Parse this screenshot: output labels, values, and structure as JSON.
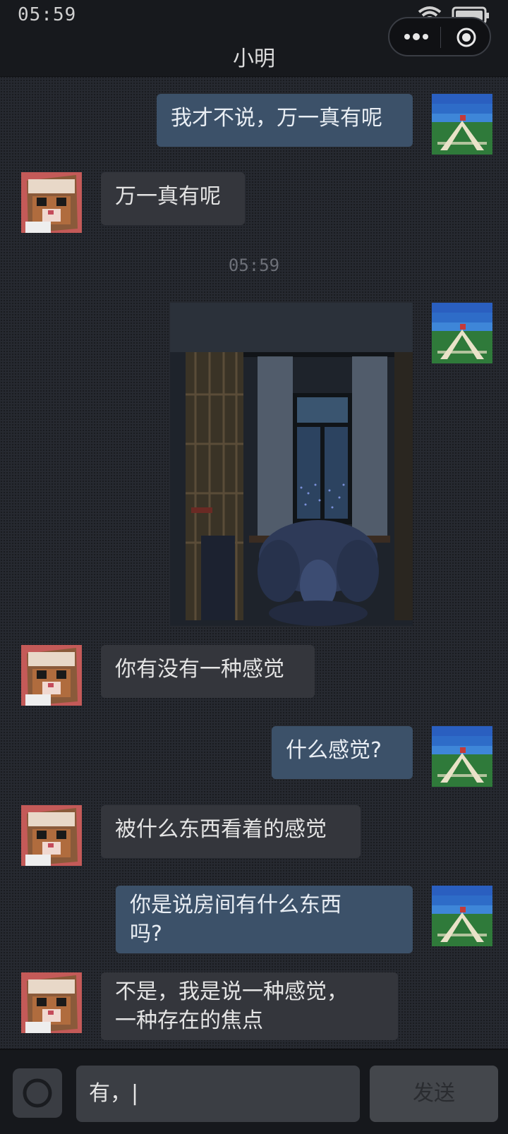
{
  "status_bar": {
    "time": "05:59"
  },
  "header": {
    "title": "小明"
  },
  "messages": [
    {
      "from": "me",
      "text": "我才不说，万一真有呢"
    },
    {
      "from": "them",
      "text": "万一真有呢"
    },
    {
      "type": "timestamp",
      "text": "05:59"
    },
    {
      "from": "me",
      "type": "image"
    },
    {
      "from": "them",
      "text": "你有没有一种感觉"
    },
    {
      "from": "me",
      "text": "什么感觉?"
    },
    {
      "from": "them",
      "text": "被什么东西看着的感觉"
    },
    {
      "from": "me",
      "text": "你是说房间有什么东西\n吗?"
    },
    {
      "from": "them",
      "text": "不是，我是说一种感觉，\n一种存在的焦点"
    }
  ],
  "composer": {
    "input_value": "有，|",
    "send_label": "发送"
  },
  "colors": {
    "my_bubble": "#3c5169",
    "their_bubble": "#34363c",
    "background": "#24272e"
  }
}
